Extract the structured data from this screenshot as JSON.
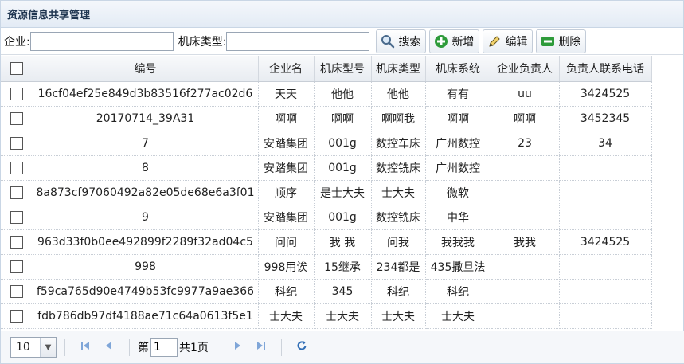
{
  "panel": {
    "title": "资源信息共享管理"
  },
  "toolbar": {
    "company_label": "企业:",
    "company_value": "",
    "type_label": "机床类型:",
    "type_value": "",
    "search_label": "搜索",
    "add_label": "新增",
    "edit_label": "编辑",
    "delete_label": "删除"
  },
  "table": {
    "headers": [
      "编号",
      "企业名",
      "机床型号",
      "机床类型",
      "机床系统",
      "企业负责人",
      "负责人联系电话"
    ],
    "rows": [
      [
        "16cf04ef25e849d3b83516f277ac02d6",
        "天天",
        "他他",
        "他他",
        "有有",
        "uu",
        "3424525"
      ],
      [
        "20170714_39A31",
        "啊啊",
        "啊啊",
        "啊啊我",
        "啊啊",
        "啊啊",
        "3452345"
      ],
      [
        "7",
        "安踏集团",
        "001g",
        "数控车床",
        "广州数控",
        "23",
        "34"
      ],
      [
        "8",
        "安踏集团",
        "001g",
        "数控铣床",
        "广州数控",
        "",
        ""
      ],
      [
        "8a873cf97060492a82e05de68e6a3f01",
        "顺序",
        "是士大夫",
        "士大夫",
        "微软",
        "",
        ""
      ],
      [
        "9",
        "安踏集团",
        "001g",
        "数控铣床",
        "中华",
        "",
        ""
      ],
      [
        "963d33f0b0ee492899f2289f32ad04c5",
        "问问",
        "我 我",
        "问我",
        "我我我",
        "我我",
        "3424525"
      ],
      [
        "998",
        "998用诶",
        "15继承",
        "234都是",
        "435撒旦法",
        "",
        ""
      ],
      [
        "f59ca765d90e4749b53fc9977a9ae366",
        "科纪",
        "345",
        "科纪",
        "科纪",
        "",
        ""
      ],
      [
        "fdb786db97df4188ae71c64a0613f5e1",
        "士大夫",
        "士大夫",
        "士大夫",
        "士大夫",
        "",
        ""
      ]
    ]
  },
  "pager": {
    "page_size": "10",
    "page_prefix": "第",
    "page_number": "1",
    "page_total": "共1页"
  },
  "icons": {
    "search": "magnifier-icon",
    "add": "plus-icon",
    "edit": "pencil-icon",
    "delete": "minus-icon",
    "first": "first-page-icon",
    "prev": "prev-page-icon",
    "next": "next-page-icon",
    "last": "last-page-icon",
    "refresh": "refresh-icon"
  },
  "colors": {
    "header_bg": "#e3ebf5",
    "pager_icon": "#7fa6d8",
    "add_green": "#2e9b3a",
    "delete_green": "#2e9b3a",
    "refresh_blue": "#2f6db5"
  }
}
